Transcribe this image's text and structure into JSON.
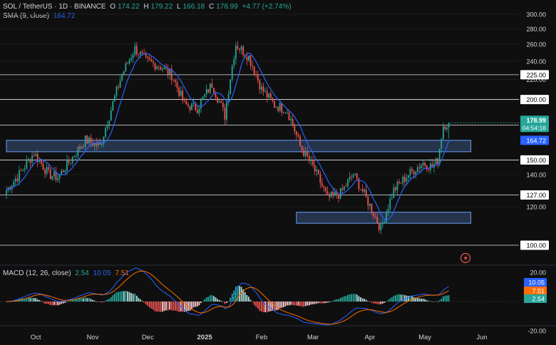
{
  "header": {
    "symbol": "SOL / TetherUS · 1D · BINANCE",
    "o_label": "O",
    "o": "174.22",
    "h_label": "H",
    "h": "179.22",
    "l_label": "L",
    "l": "166.18",
    "c_label": "C",
    "c": "178.99",
    "change": "+4.77 (+2.74%)"
  },
  "sma_legend": {
    "label": "SMA (9, close)",
    "value": "164.72"
  },
  "macd_legend": {
    "label": "MACD (12, 26, close)",
    "v1": "2.54",
    "v2": "10.05",
    "v3": "7.51"
  },
  "colors": {
    "up": "#26a69a",
    "down": "#ef5350",
    "sma": "#2962ff",
    "macd": "#2962ff",
    "signal": "#ff6d00",
    "zone": "#5b8bd6"
  },
  "chart_data": [
    {
      "type": "candlestick",
      "title": "SOL / TetherUS · 1D · BINANCE",
      "y_ticks": [
        "300.00",
        "280.00",
        "260.00",
        "240.00",
        "220.00",
        "200.00",
        "177.00",
        "150.00",
        "140.00",
        "127.00",
        "120.00",
        "100.00"
      ],
      "ylim": [
        95,
        302
      ],
      "scale": "log",
      "x_ticks": [
        "Oct",
        "Nov",
        "Dec",
        "2025",
        "Feb",
        "Mar",
        "Apr",
        "May",
        "Jun"
      ],
      "key_levels": [
        225,
        200,
        177,
        150,
        127,
        100
      ],
      "key_level_labels": [
        "225.00",
        "200.00",
        "177.00",
        "150.00",
        "127.00",
        "100.00"
      ],
      "zones": [
        {
          "from_date": "2024-09-15",
          "to_date": "2025-05-26",
          "low": 156,
          "high": 164.72
        },
        {
          "from_date": "2025-02-20",
          "to_date": "2025-05-26",
          "low": 111,
          "high": 117
        }
      ],
      "price_label": {
        "value": "178.99",
        "countdown": "04:54:16"
      },
      "sma_label": "164.72",
      "anchors": [
        [
          "2024-09-15",
          130
        ],
        [
          "2024-09-22",
          140
        ],
        [
          "2024-09-30",
          155
        ],
        [
          "2024-10-08",
          140
        ],
        [
          "2024-10-13",
          138
        ],
        [
          "2024-10-20",
          150
        ],
        [
          "2024-10-28",
          165
        ],
        [
          "2024-11-05",
          160
        ],
        [
          "2024-11-10",
          185
        ],
        [
          "2024-11-17",
          225
        ],
        [
          "2024-11-24",
          255
        ],
        [
          "2024-11-30",
          240
        ],
        [
          "2024-12-07",
          235
        ],
        [
          "2024-12-14",
          225
        ],
        [
          "2024-12-21",
          195
        ],
        [
          "2024-12-28",
          192
        ],
        [
          "2025-01-05",
          215
        ],
        [
          "2025-01-12",
          185
        ],
        [
          "2025-01-18",
          260
        ],
        [
          "2025-01-25",
          245
        ],
        [
          "2025-02-01",
          210
        ],
        [
          "2025-02-08",
          195
        ],
        [
          "2025-02-15",
          190
        ],
        [
          "2025-02-22",
          160
        ],
        [
          "2025-03-01",
          145
        ],
        [
          "2025-03-09",
          125
        ],
        [
          "2025-03-16",
          128
        ],
        [
          "2025-03-23",
          140
        ],
        [
          "2025-03-30",
          125
        ],
        [
          "2025-04-07",
          108
        ],
        [
          "2025-04-14",
          130
        ],
        [
          "2025-04-22",
          140
        ],
        [
          "2025-04-30",
          148
        ],
        [
          "2025-05-05",
          145
        ],
        [
          "2025-05-08",
          150
        ],
        [
          "2025-05-11",
          177
        ],
        [
          "2025-05-14",
          178.99
        ]
      ]
    },
    {
      "type": "line",
      "title": "MACD (12, 26, close)",
      "y_ticks": [
        "20.00",
        "-20.00"
      ],
      "ylim": [
        -22,
        22
      ],
      "series": [
        {
          "name": "MACD",
          "values_label": "10.05"
        },
        {
          "name": "Signal",
          "values_label": "7.51"
        },
        {
          "name": "Histogram",
          "values_label": "2.54"
        }
      ]
    }
  ]
}
